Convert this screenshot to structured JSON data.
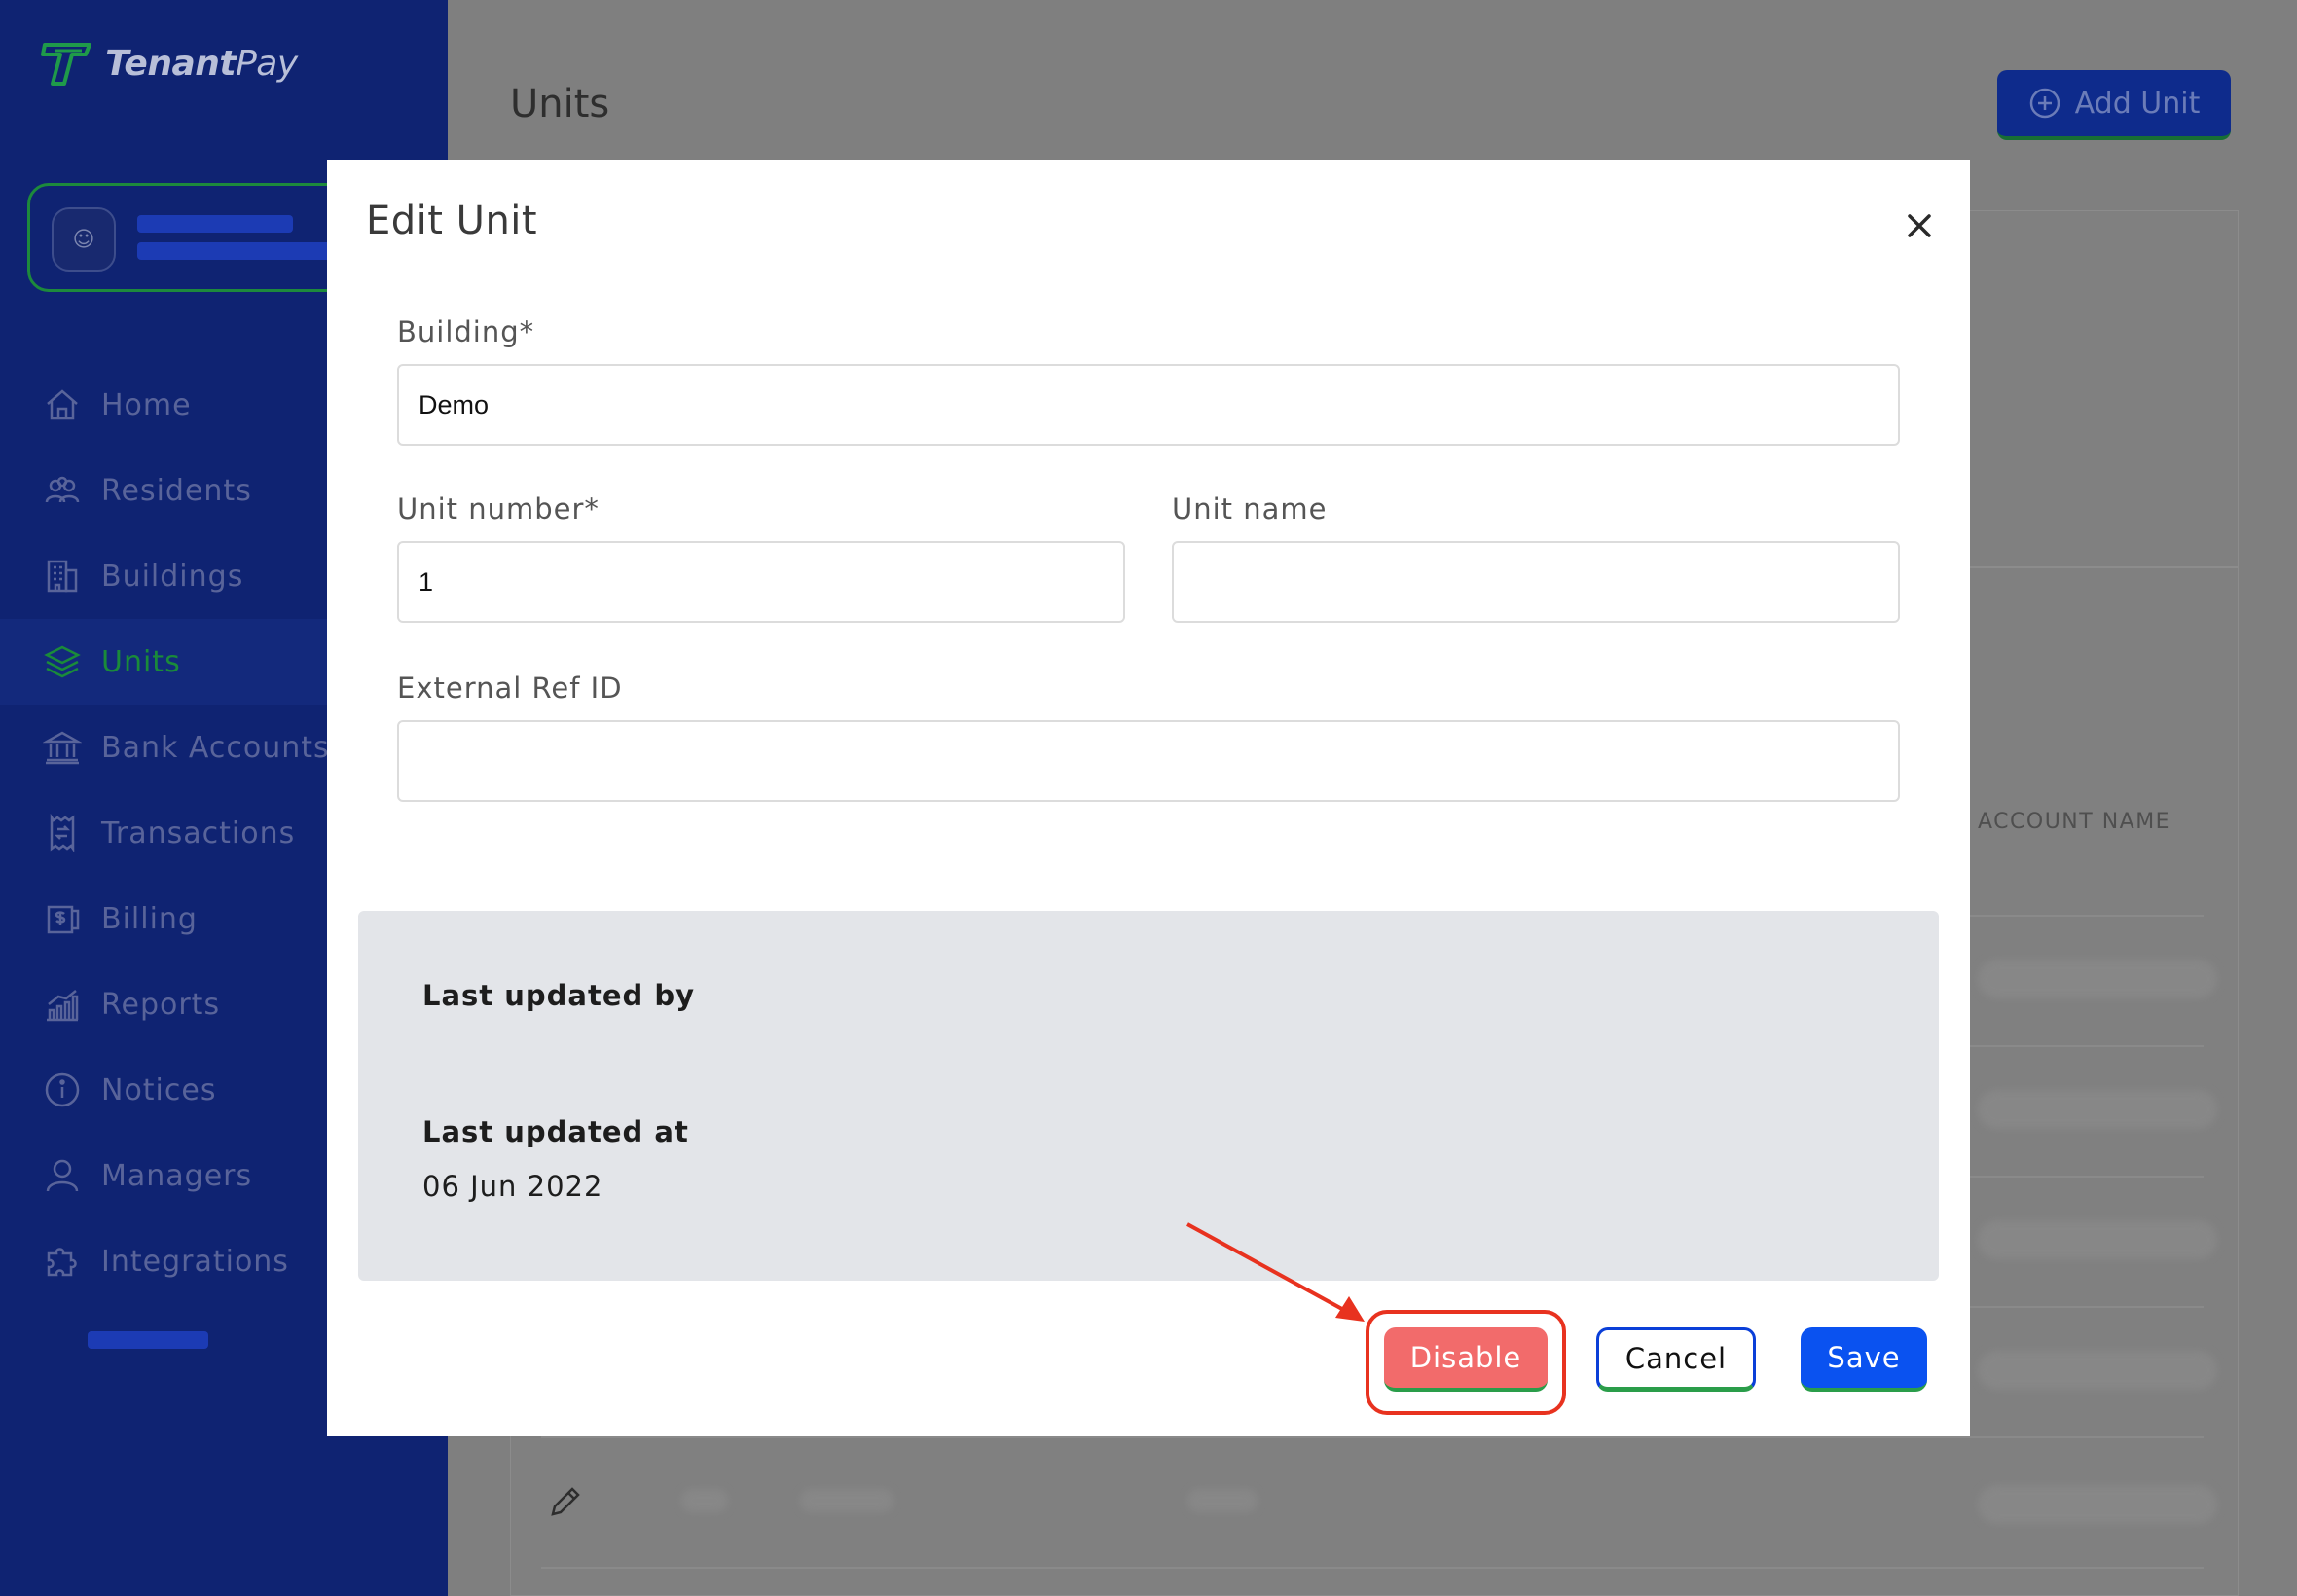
{
  "app": {
    "logo_text_bold": "Tenant",
    "logo_text_light": "Pay"
  },
  "sidebar": {
    "items": [
      {
        "label": "Home",
        "icon": "home-icon",
        "active": false
      },
      {
        "label": "Residents",
        "icon": "residents-icon",
        "active": false
      },
      {
        "label": "Buildings",
        "icon": "buildings-icon",
        "active": false
      },
      {
        "label": "Units",
        "icon": "layers-icon",
        "active": true
      },
      {
        "label": "Bank Accounts",
        "icon": "bank-icon",
        "active": false
      },
      {
        "label": "Transactions",
        "icon": "receipt-icon",
        "active": false
      },
      {
        "label": "Billing",
        "icon": "billing-icon",
        "active": false
      },
      {
        "label": "Reports",
        "icon": "reports-icon",
        "active": false
      },
      {
        "label": "Notices",
        "icon": "info-icon",
        "active": false
      },
      {
        "label": "Managers",
        "icon": "user-icon",
        "active": false
      },
      {
        "label": "Integrations",
        "icon": "puzzle-icon",
        "active": false
      }
    ]
  },
  "page": {
    "title": "Units",
    "add_button_label": "Add Unit",
    "table_column_header": "ACCOUNT NAME"
  },
  "modal": {
    "title": "Edit Unit",
    "building_label": "Building*",
    "building_value": "Demo",
    "unit_number_label": "Unit number*",
    "unit_number_value": "1",
    "unit_name_label": "Unit name",
    "unit_name_value": "",
    "external_ref_label": "External Ref ID",
    "external_ref_value": "",
    "last_updated_by_label": "Last updated by",
    "last_updated_at_label": "Last updated at",
    "last_updated_at_value": "06 Jun 2022",
    "disable_label": "Disable",
    "cancel_label": "Cancel",
    "save_label": "Save"
  },
  "colors": {
    "sidebar_bg": "#0f2372",
    "active_green": "#1a8b3a",
    "primary_blue": "#0a52f0",
    "disable_red": "#f26b6b",
    "annotation_red": "#e8321f"
  }
}
